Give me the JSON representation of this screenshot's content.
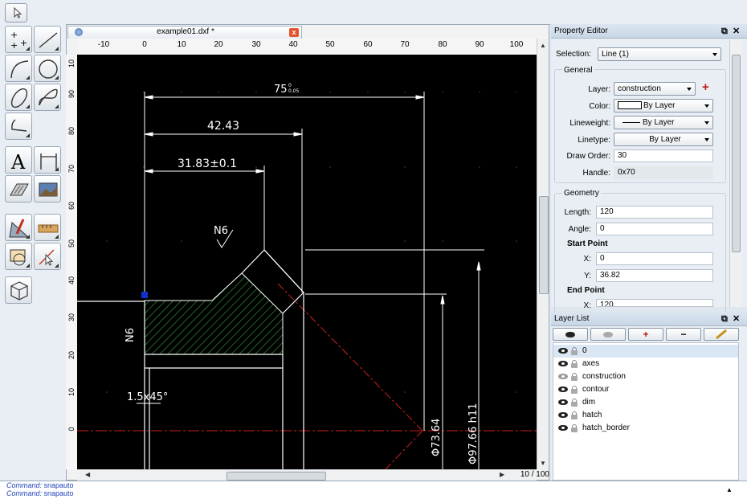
{
  "document": {
    "tab_title": "example01.dxf *",
    "close_glyph": "x",
    "page_indicator": "10 / 100"
  },
  "ruler": {
    "x_ticks": [
      "-10",
      "0",
      "10",
      "20",
      "30",
      "40",
      "50",
      "60",
      "70",
      "80",
      "90",
      "100"
    ],
    "y_ticks": [
      "10",
      "90",
      "80",
      "70",
      "60",
      "50",
      "40",
      "30",
      "20",
      "10",
      "0"
    ]
  },
  "drawing": {
    "dim_top": "75",
    "dim_top_tol_upper": "0",
    "dim_top_tol_lower": "0.05",
    "dim_mid": "42.43",
    "dim_low": "31.83±0.1",
    "surface_top": "N6",
    "surface_left": "N6",
    "chamfer": "1.5x45°",
    "dia_1": "Φ73.64",
    "dia_2": "Φ97.66 h11",
    "colors": {
      "background": "#000000",
      "line": "#ffffff",
      "hatch": "#2fae3c",
      "axis": "#d02020",
      "grip": "#1030d0"
    }
  },
  "property_editor": {
    "title": "Property Editor",
    "selection_label": "Selection:",
    "selection_value": "Line (1)",
    "general_title": "General",
    "layer_label": "Layer:",
    "layer_value": "construction",
    "color_label": "Color:",
    "color_value": "By Layer",
    "lineweight_label": "Lineweight:",
    "lineweight_value": "By Layer",
    "linetype_label": "Linetype:",
    "linetype_value": "By Layer",
    "draworder_label": "Draw Order:",
    "draworder_value": "30",
    "handle_label": "Handle:",
    "handle_value": "0x70",
    "geometry_title": "Geometry",
    "length_label": "Length:",
    "length_value": "120",
    "angle_label": "Angle:",
    "angle_value": "0",
    "start_point_label": "Start Point",
    "start_x_label": "X:",
    "start_x_value": "0",
    "start_y_label": "Y:",
    "start_y_value": "36.82",
    "end_point_label": "End Point",
    "end_x_label": "X:",
    "end_x_value": "120"
  },
  "layer_list": {
    "title": "Layer List",
    "layers": [
      {
        "name": "0",
        "visible": true
      },
      {
        "name": "axes",
        "visible": true
      },
      {
        "name": "construction",
        "visible": false
      },
      {
        "name": "contour",
        "visible": true
      },
      {
        "name": "dim",
        "visible": true
      },
      {
        "name": "hatch",
        "visible": true
      },
      {
        "name": "hatch_border",
        "visible": true
      }
    ]
  },
  "command_history": [
    {
      "prefix": "Command:",
      "text": "snapauto"
    },
    {
      "prefix": "Command:",
      "text": "snapauto"
    }
  ]
}
